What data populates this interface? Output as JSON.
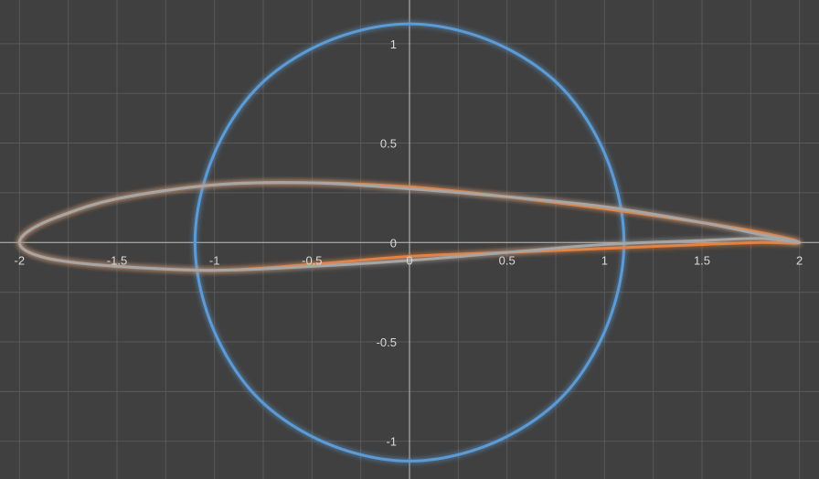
{
  "chart_data": {
    "type": "scatter",
    "title": "",
    "xlabel": "",
    "ylabel": "",
    "xlim": [
      -2.1,
      2.1
    ],
    "ylim": [
      -1.19,
      1.22
    ],
    "grid": true,
    "legend": "none",
    "x_ticks": [
      {
        "value": -2,
        "label": "-2"
      },
      {
        "value": -1.5,
        "label": "-1.5"
      },
      {
        "value": -1,
        "label": "-1"
      },
      {
        "value": -0.5,
        "label": "-0.5"
      },
      {
        "value": 0,
        "label": "0"
      },
      {
        "value": 0.5,
        "label": "0.5"
      },
      {
        "value": 1,
        "label": "1"
      },
      {
        "value": 1.5,
        "label": "1.5"
      },
      {
        "value": 2,
        "label": "2"
      }
    ],
    "y_ticks": [
      {
        "value": 1,
        "label": "1"
      },
      {
        "value": 0.5,
        "label": "0.5"
      },
      {
        "value": 0,
        "label": "0"
      },
      {
        "value": -0.5,
        "label": "-0.5"
      },
      {
        "value": -1,
        "label": "-1"
      }
    ],
    "series": [
      {
        "color": "#5b9bd5",
        "closed": true,
        "points": [
          [
            1.1,
            0.0
          ],
          [
            1.06,
            0.28
          ],
          [
            0.95,
            0.55
          ],
          [
            0.78,
            0.78
          ],
          [
            0.55,
            0.95
          ],
          [
            0.28,
            1.06
          ],
          [
            0.0,
            1.1
          ],
          [
            -0.28,
            1.06
          ],
          [
            -0.55,
            0.95
          ],
          [
            -0.78,
            0.78
          ],
          [
            -0.95,
            0.55
          ],
          [
            -1.06,
            0.28
          ],
          [
            -1.1,
            0.0
          ],
          [
            -1.06,
            -0.28
          ],
          [
            -0.95,
            -0.55
          ],
          [
            -0.78,
            -0.78
          ],
          [
            -0.55,
            -0.95
          ],
          [
            -0.28,
            -1.06
          ],
          [
            0.0,
            -1.1
          ],
          [
            0.28,
            -1.06
          ],
          [
            0.55,
            -0.95
          ],
          [
            0.78,
            -0.78
          ],
          [
            0.95,
            -0.55
          ],
          [
            1.06,
            -0.28
          ]
        ]
      },
      {
        "color": "#ed7d31",
        "closed": true,
        "points": [
          [
            2.0,
            0.0
          ],
          [
            1.8,
            0.05
          ],
          [
            1.5,
            0.1
          ],
          [
            1.0,
            0.17
          ],
          [
            0.5,
            0.23
          ],
          [
            0.0,
            0.28
          ],
          [
            -0.5,
            0.3
          ],
          [
            -1.0,
            0.29
          ],
          [
            -1.5,
            0.22
          ],
          [
            -1.8,
            0.13
          ],
          [
            -1.95,
            0.06
          ],
          [
            -2.0,
            0.0
          ],
          [
            -1.95,
            -0.05
          ],
          [
            -1.8,
            -0.09
          ],
          [
            -1.5,
            -0.12
          ],
          [
            -1.0,
            -0.14
          ],
          [
            -0.5,
            -0.11
          ],
          [
            0.0,
            -0.07
          ],
          [
            0.5,
            -0.05
          ],
          [
            1.0,
            -0.03
          ],
          [
            1.5,
            -0.01
          ],
          [
            1.8,
            0.0
          ]
        ]
      },
      {
        "color": "#a6a6a6",
        "closed": true,
        "points": [
          [
            2.0,
            0.0
          ],
          [
            1.8,
            0.04
          ],
          [
            1.5,
            0.1
          ],
          [
            1.0,
            0.18
          ],
          [
            0.5,
            0.23
          ],
          [
            0.0,
            0.27
          ],
          [
            -0.5,
            0.3
          ],
          [
            -1.0,
            0.29
          ],
          [
            -1.5,
            0.22
          ],
          [
            -1.8,
            0.13
          ],
          [
            -1.95,
            0.06
          ],
          [
            -2.0,
            0.0
          ],
          [
            -1.95,
            -0.05
          ],
          [
            -1.8,
            -0.09
          ],
          [
            -1.5,
            -0.12
          ],
          [
            -1.0,
            -0.14
          ],
          [
            -0.5,
            -0.12
          ],
          [
            0.0,
            -0.09
          ],
          [
            0.5,
            -0.05
          ],
          [
            1.0,
            -0.01
          ],
          [
            1.5,
            0.01
          ],
          [
            1.8,
            0.02
          ]
        ]
      },
      {
        "color": "#a6a6a6",
        "closed": false,
        "points": [
          [
            -2.0,
            0.0
          ],
          [
            2.0,
            0.0
          ]
        ]
      }
    ]
  }
}
